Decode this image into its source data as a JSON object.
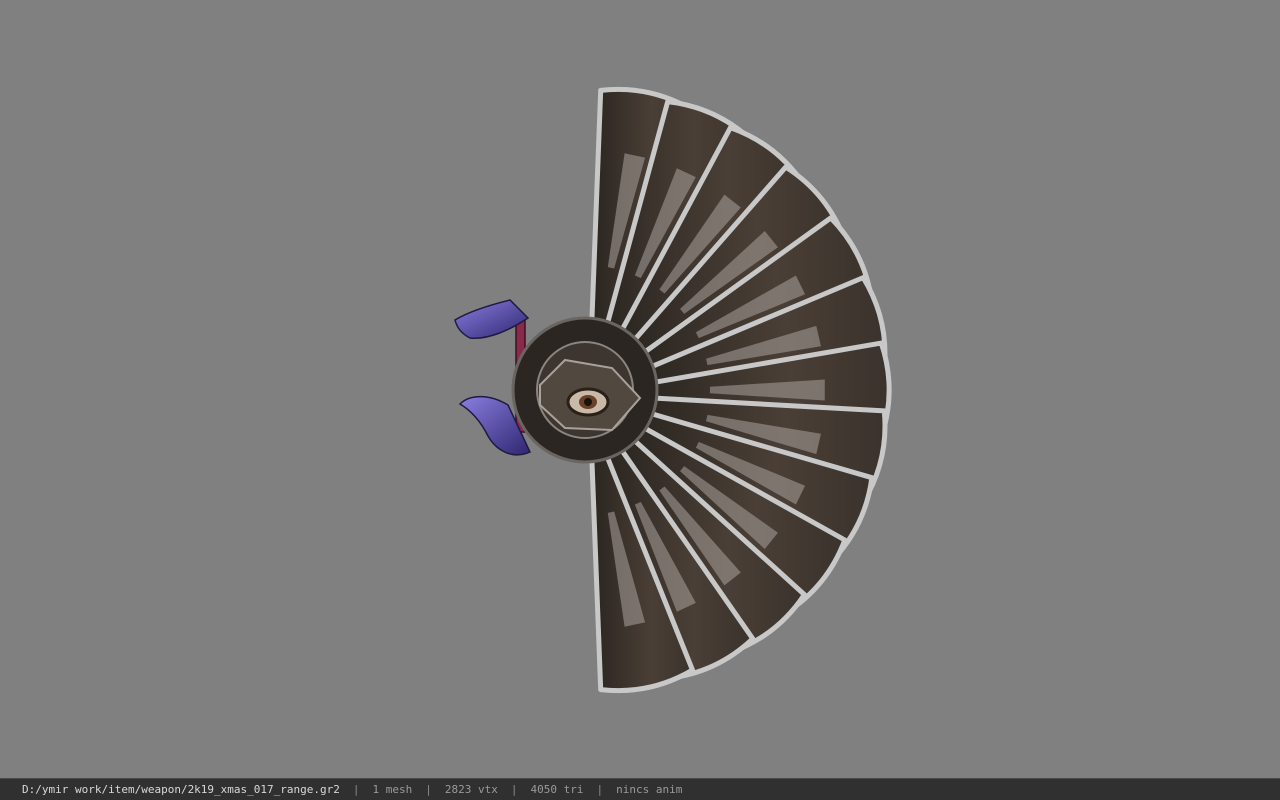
{
  "viewer": {
    "background_color": "#808080",
    "model": {
      "name": "weapon-fan-model",
      "blade_dark": "#3a322c",
      "blade_edge": "#c8c8c8",
      "claw_color": "#5b4fb0",
      "handle_color": "#8a2a4a"
    }
  },
  "statusbar": {
    "file_path": "D:/ymir work/item/weapon/2k19_xmas_017_range.gr2",
    "separator": "|",
    "mesh": "1 mesh",
    "vertices": "2823 vtx",
    "triangles": "4050 tri",
    "animation": "nincs anim"
  }
}
